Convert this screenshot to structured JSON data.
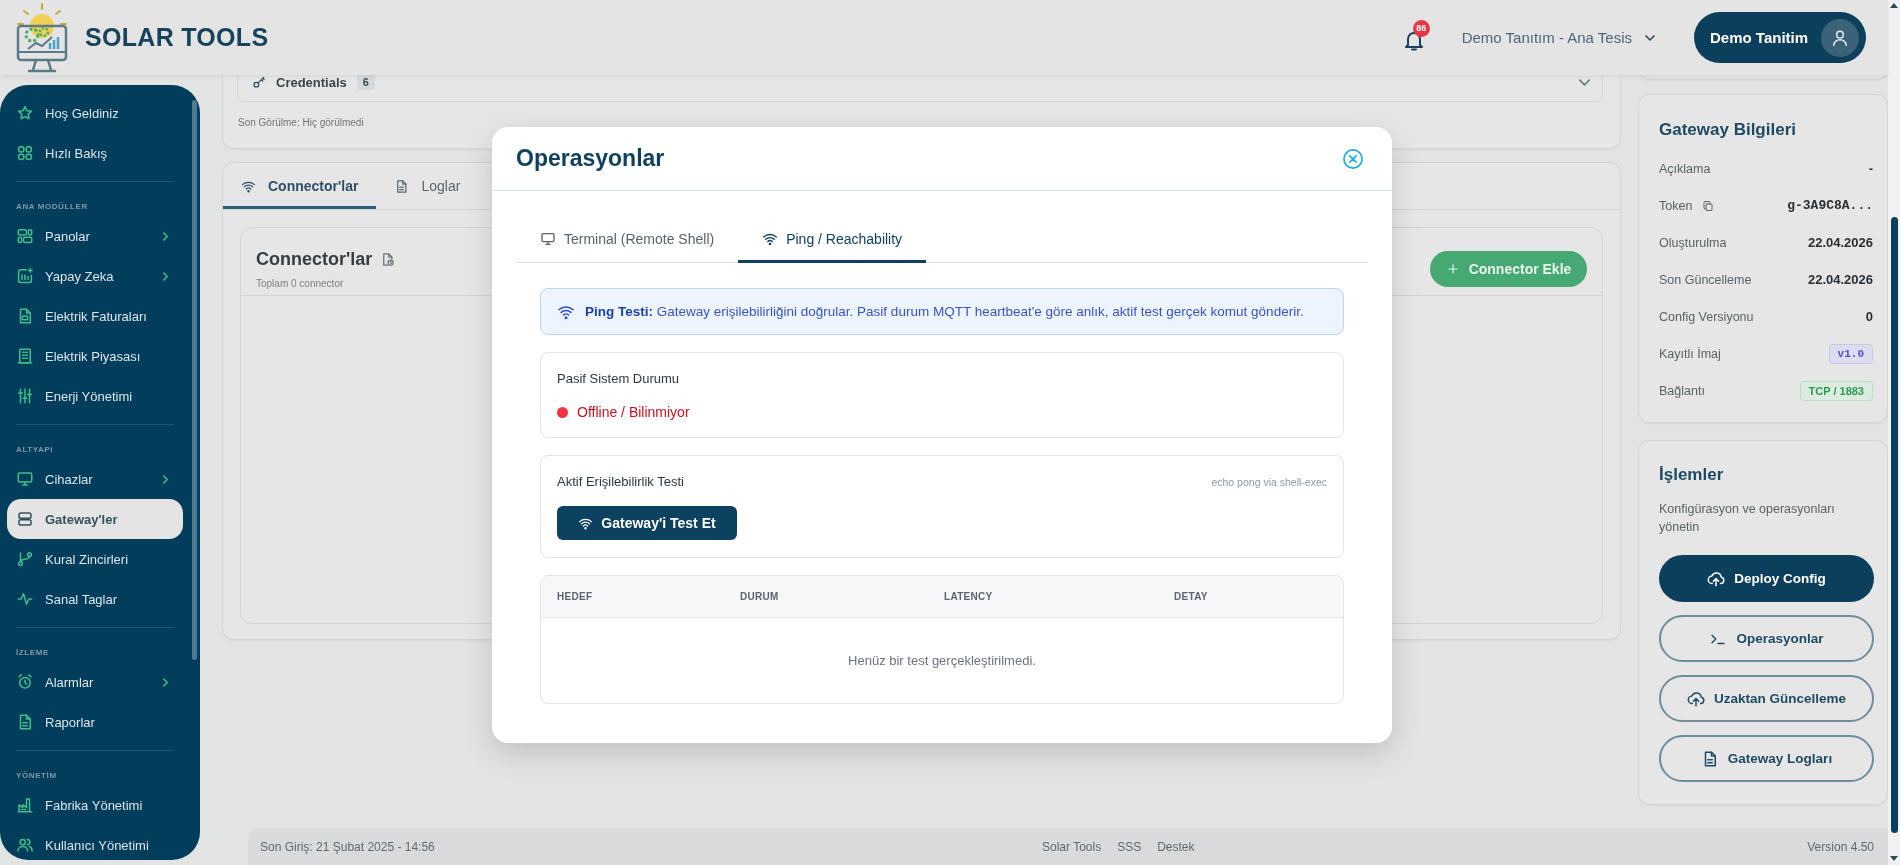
{
  "header": {
    "logo_text": "SOLAR TOOLS",
    "notification_count": "86",
    "facility": "Demo Tanıtım - Ana Tesis",
    "user_name": "Demo Tanitim"
  },
  "sidebar": {
    "groups": [
      {
        "items": [
          {
            "label": "Hoş Geldiniz",
            "selected": false,
            "has_submenu": false
          },
          {
            "label": "Hızlı Bakış",
            "selected": false,
            "has_submenu": false
          }
        ]
      },
      {
        "title": "ANA MODÜLLER",
        "items": [
          {
            "label": "Panolar",
            "selected": false,
            "has_submenu": true
          },
          {
            "label": "Yapay Zeka",
            "selected": false,
            "has_submenu": true
          },
          {
            "label": "Elektrik Faturaları",
            "selected": false,
            "has_submenu": false
          },
          {
            "label": "Elektrik Piyasası",
            "selected": false,
            "has_submenu": false
          },
          {
            "label": "Enerji Yönetimi",
            "selected": false,
            "has_submenu": false
          }
        ]
      },
      {
        "title": "ALTYAPI",
        "items": [
          {
            "label": "Cihazlar",
            "selected": false,
            "has_submenu": true
          },
          {
            "label": "Gateway'ler",
            "selected": true,
            "has_submenu": false
          },
          {
            "label": "Kural Zincirleri",
            "selected": false,
            "has_submenu": false
          },
          {
            "label": "Sanal Taglar",
            "selected": false,
            "has_submenu": false
          }
        ]
      },
      {
        "title": "İZLEME",
        "items": [
          {
            "label": "Alarmlar",
            "selected": false,
            "has_submenu": true
          },
          {
            "label": "Raporlar",
            "selected": false,
            "has_submenu": false
          }
        ]
      },
      {
        "title": "YÖNETİM",
        "items": [
          {
            "label": "Fabrika Yönetimi",
            "selected": false,
            "has_submenu": false
          },
          {
            "label": "Kullanıcı Yönetimi",
            "selected": false,
            "has_submenu": false
          }
        ]
      }
    ]
  },
  "gateway_summary": {
    "credentials_label": "Credentials",
    "credentials_count": "6",
    "last_seen": "Son Görülme: Hiç görülmedi"
  },
  "detail_tabs": [
    {
      "label": "Connector'lar",
      "selected": true
    },
    {
      "label": "Loglar",
      "selected": false
    }
  ],
  "connectors": {
    "title": "Connector'lar",
    "subtitle": "Toplam 0 connector",
    "add_button": "Connector Ekle"
  },
  "gateway_info": {
    "title": "Gateway Bilgileri",
    "rows": [
      {
        "label": "Açıklama",
        "value": "-",
        "kind": "text"
      },
      {
        "label": "Token",
        "value": "g-3A9C8A...",
        "kind": "token"
      },
      {
        "label": "Oluşturulma",
        "value": "22.04.2026",
        "kind": "text"
      },
      {
        "label": "Son Güncelleme",
        "value": "22.04.2026",
        "kind": "text"
      },
      {
        "label": "Config Versiyonu",
        "value": "0",
        "kind": "text"
      },
      {
        "label": "Kayıtlı İmaj",
        "value": "v1.0",
        "kind": "version_badge"
      },
      {
        "label": "Bağlantı",
        "value": "TCP / 1883",
        "kind": "connection_badge"
      }
    ]
  },
  "actions": {
    "title": "İşlemler",
    "description": "Konfigürasyon ve operasyonları yönetin",
    "buttons": [
      {
        "label": "Deploy Config",
        "kind": "primary"
      },
      {
        "label": "Operasyonlar",
        "kind": "outline"
      },
      {
        "label": "Uzaktan Güncelleme",
        "kind": "outline"
      },
      {
        "label": "Gateway Logları",
        "kind": "outline"
      }
    ]
  },
  "footer": {
    "last_login": "Son Giriş: 21 Şubat 2025 - 14:56",
    "links": [
      "Solar Tools",
      "SSS",
      "Destek"
    ],
    "version": "Version 4.50"
  },
  "modal": {
    "title": "Operasyonlar",
    "tabs": [
      {
        "label": "Terminal (Remote Shell)",
        "selected": false
      },
      {
        "label": "Ping / Reachability",
        "selected": true
      }
    ],
    "info": "**Ping Testi:** Gateway erişilebilirliğini doğrular. Pasif durum MQTT heartbeat'e göre anlık, aktif test gerçek komut gönderir.",
    "passive": {
      "title": "Pasif Sistem Durumu",
      "status": "Offline / Bilinmiyor",
      "online": false
    },
    "active": {
      "title": "Aktif Erişilebilirlik Testi",
      "hint": "echo pong via shell-exec",
      "button": "Gateway'i Test Et"
    },
    "results": {
      "columns": [
        "HEDEF",
        "DURUM",
        "LATENCY",
        "DETAY"
      ],
      "empty_message": "Henüz bir test gerçekleştirilmedi."
    }
  }
}
